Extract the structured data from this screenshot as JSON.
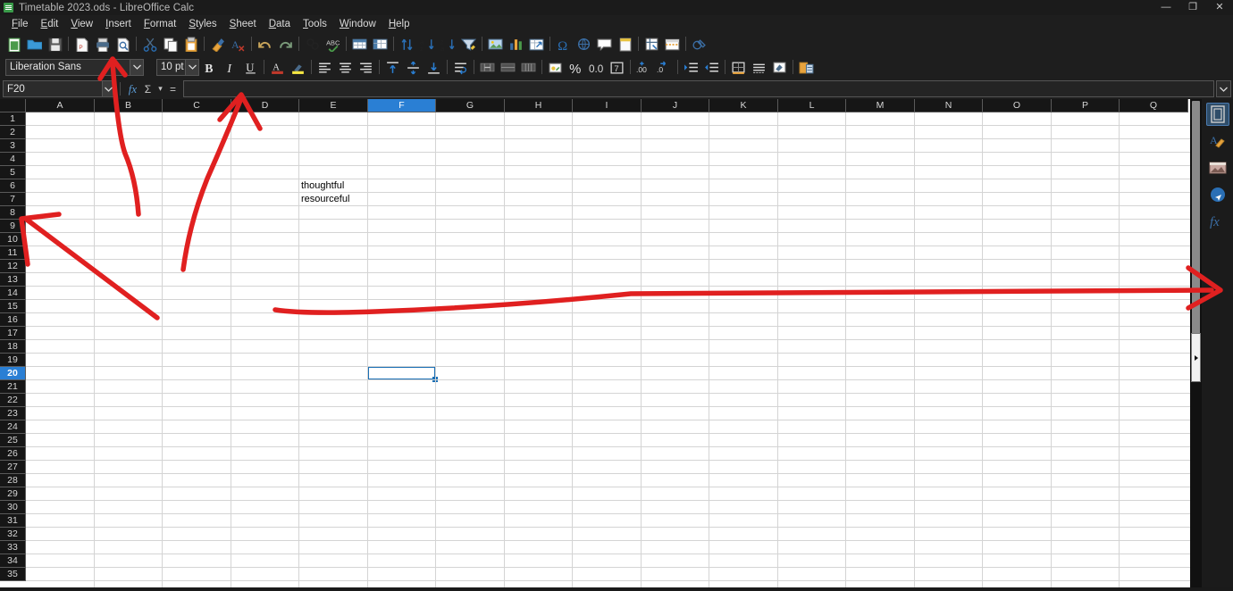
{
  "window": {
    "title": "Timetable 2023.ods - LibreOffice Calc",
    "app_icon": "calc-document-icon",
    "minimize": "—",
    "maximize": "❐",
    "close": "✕"
  },
  "menubar": {
    "items": [
      {
        "label": "File",
        "name": "menu-file"
      },
      {
        "label": "Edit",
        "name": "menu-edit"
      },
      {
        "label": "View",
        "name": "menu-view"
      },
      {
        "label": "Insert",
        "name": "menu-insert"
      },
      {
        "label": "Format",
        "name": "menu-format"
      },
      {
        "label": "Styles",
        "name": "menu-styles"
      },
      {
        "label": "Sheet",
        "name": "menu-sheet"
      },
      {
        "label": "Data",
        "name": "menu-data"
      },
      {
        "label": "Tools",
        "name": "menu-tools"
      },
      {
        "label": "Window",
        "name": "menu-window"
      },
      {
        "label": "Help",
        "name": "menu-help"
      }
    ]
  },
  "standard_toolbar": {
    "items": [
      "new-document-icon",
      "open-file-icon",
      "save-icon",
      "sep",
      "export-pdf-icon",
      "print-icon",
      "print-preview-icon",
      "sep",
      "cut-icon",
      "copy-icon",
      "paste-icon",
      "sep",
      "clone-formatting-icon",
      "clear-formatting-icon",
      "sep",
      "undo-icon",
      "redo-icon",
      "sep",
      "find-replace-icon",
      "spelling-icon",
      "sep",
      "row-icon",
      "column-icon",
      "sep",
      "sort-icon",
      "sort-ascending-icon",
      "sort-descending-icon",
      "autofilter-icon",
      "sep",
      "insert-image-icon",
      "insert-chart-icon",
      "pivot-table-icon",
      "sep",
      "special-character-icon",
      "hyperlink-icon",
      "comment-icon",
      "headers-footers-icon",
      "sep",
      "freeze-rows-columns-icon",
      "split-window-icon",
      "sep",
      "show-draw-functions-icon"
    ]
  },
  "formatting_toolbar": {
    "font_name": "Liberation Sans",
    "font_size": "10 pt",
    "items": [
      "bold-icon",
      "italic-icon",
      "underline-icon",
      "sep",
      "font-color-icon",
      "highlighting-color-icon",
      "sep",
      "align-left-icon",
      "align-center-icon",
      "align-right-icon",
      "sep",
      "align-top-icon",
      "center-vertically-icon",
      "align-bottom-icon",
      "sep",
      "wrap-text-icon",
      "sep",
      "merge-and-center-cells-icon",
      "merge-cells-icon",
      "unmerge-cells-icon",
      "sep",
      "currency-format-icon",
      "percent-format-icon",
      "number-format-icon",
      "date-format-icon",
      "sep",
      "add-decimal-place-icon",
      "delete-decimal-place-icon",
      "sep",
      "increase-indent-icon",
      "decrease-indent-icon",
      "sep",
      "borders-icon",
      "border-style-icon",
      "background-color-icon",
      "sep",
      "cell-styles-icon"
    ]
  },
  "formula_bar": {
    "name_box_value": "F20",
    "name_box_dropdown": "chevron-down-icon",
    "function_wizard": "fx",
    "sum_icon": "Σ",
    "sum_dropdown": "▾",
    "formula_icon": "=",
    "input_line_value": "",
    "expand_icon": "▾"
  },
  "sheet": {
    "columns": [
      "A",
      "B",
      "C",
      "D",
      "E",
      "F",
      "G",
      "H",
      "I",
      "J",
      "K",
      "L",
      "M",
      "N",
      "O",
      "P",
      "Q"
    ],
    "selected_column": "F",
    "rows": [
      1,
      2,
      3,
      4,
      5,
      6,
      7,
      8,
      9,
      10,
      11,
      12,
      13,
      14,
      15,
      16,
      17,
      18,
      19,
      20,
      21,
      22,
      23,
      24,
      25,
      26,
      27,
      28,
      29,
      30,
      31,
      32,
      33,
      34,
      35
    ],
    "selected_row": 20,
    "active_cell": "F20",
    "cell_values": [
      {
        "ref": "E6",
        "col": "E",
        "row": 6,
        "text": "thoughtful"
      },
      {
        "ref": "E7",
        "col": "E",
        "row": 7,
        "text": "resourceful"
      }
    ]
  },
  "sidebar": {
    "items": [
      {
        "name": "sidebar-properties-icon",
        "label": "Properties",
        "active": true
      },
      {
        "name": "sidebar-styles-icon",
        "label": "Styles",
        "active": false
      },
      {
        "name": "sidebar-gallery-icon",
        "label": "Gallery",
        "active": false
      },
      {
        "name": "sidebar-navigator-icon",
        "label": "Navigator",
        "active": false
      },
      {
        "name": "sidebar-functions-icon",
        "label": "Functions",
        "active": false
      }
    ]
  },
  "annotations": {
    "color": "#e02020",
    "marks": [
      {
        "name": "arrow-to-font-name-box",
        "type": "arrow",
        "target": "font name combo box"
      },
      {
        "name": "arrow-to-formula-input-line",
        "type": "arrow",
        "target": "formula bar input line"
      },
      {
        "name": "arrow-to-row-headers",
        "type": "arrow",
        "target": "row header area rows 8-9"
      },
      {
        "name": "arrow-across-row-14",
        "type": "arrow",
        "target": "right edge of grid along row 14"
      }
    ]
  }
}
